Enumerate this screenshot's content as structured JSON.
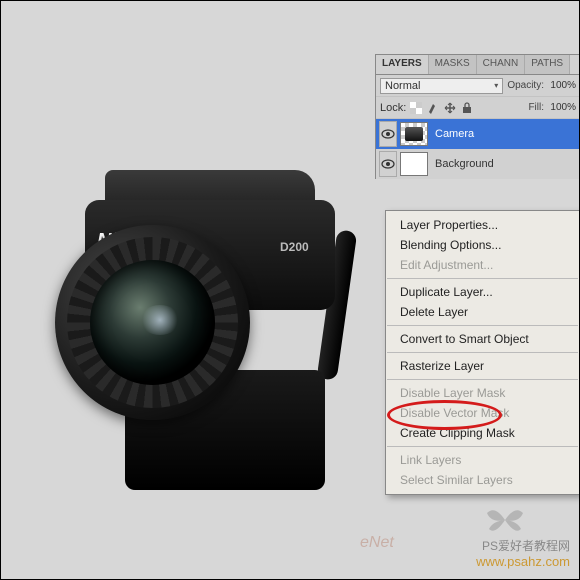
{
  "camera": {
    "brand": "Nikon",
    "model": "D200"
  },
  "panel": {
    "tabs": [
      "LAYERS",
      "MASKS",
      "CHANN",
      "PATHS"
    ],
    "active_tab": 0,
    "blend_mode": "Normal",
    "opacity_label": "Opacity:",
    "opacity_value": "100%",
    "lock_label": "Lock:",
    "fill_label": "Fill:",
    "fill_value": "100%"
  },
  "layers": [
    {
      "name": "Camera",
      "visible": true,
      "selected": true,
      "transparent": true
    },
    {
      "name": "Background",
      "visible": true,
      "selected": false,
      "transparent": false
    }
  ],
  "context_menu": [
    {
      "label": "Layer Properties...",
      "enabled": true
    },
    {
      "label": "Blending Options...",
      "enabled": true
    },
    {
      "label": "Edit Adjustment...",
      "enabled": false
    },
    {
      "sep": true
    },
    {
      "label": "Duplicate Layer...",
      "enabled": true
    },
    {
      "label": "Delete Layer",
      "enabled": true
    },
    {
      "sep": true
    },
    {
      "label": "Convert to Smart Object",
      "enabled": true
    },
    {
      "sep": true
    },
    {
      "label": "Rasterize Layer",
      "enabled": true,
      "highlighted": true
    },
    {
      "sep": true
    },
    {
      "label": "Disable Layer Mask",
      "enabled": false
    },
    {
      "label": "Disable Vector Mask",
      "enabled": false
    },
    {
      "label": "Create Clipping Mask",
      "enabled": true
    },
    {
      "sep": true
    },
    {
      "label": "Link Layers",
      "enabled": false
    },
    {
      "label": "Select Similar Layers",
      "enabled": false
    }
  ],
  "watermark": {
    "line1": "PS爱好者教程网",
    "line2": "www.psahz.com",
    "enet": "eNet"
  }
}
